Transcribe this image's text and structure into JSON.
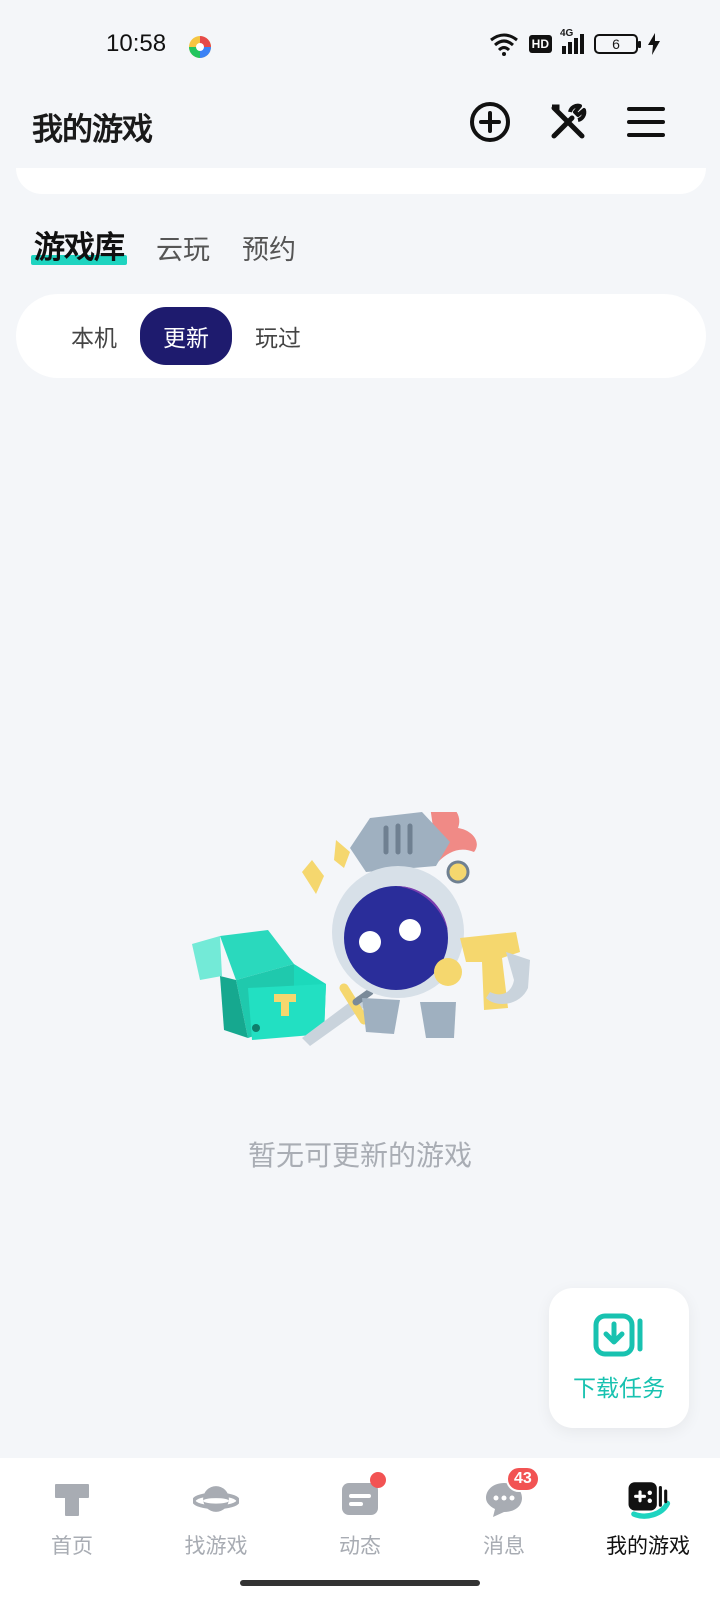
{
  "status_bar": {
    "time": "10:58",
    "network": "4G",
    "hd": "HD",
    "battery": "6"
  },
  "header": {
    "title": "我的游戏"
  },
  "main_tabs": [
    {
      "label": "游戏库",
      "active": true
    },
    {
      "label": "云玩",
      "active": false
    },
    {
      "label": "预约",
      "active": false
    }
  ],
  "sub_tabs": [
    {
      "label": "本机",
      "active": false
    },
    {
      "label": "更新",
      "active": true
    },
    {
      "label": "玩过",
      "active": false
    }
  ],
  "empty_state": {
    "message": "暂无可更新的游戏"
  },
  "download_task": {
    "label": "下载任务"
  },
  "bottom_nav": [
    {
      "label": "首页",
      "icon": "home-icon",
      "active": false
    },
    {
      "label": "找游戏",
      "icon": "planet-icon",
      "active": false
    },
    {
      "label": "动态",
      "icon": "feed-icon",
      "active": false
    },
    {
      "label": "消息",
      "icon": "message-icon",
      "active": false,
      "badge": "43"
    },
    {
      "label": "我的游戏",
      "icon": "gamepad-icon",
      "active": true
    }
  ],
  "colors": {
    "accent": "#1ed4c0",
    "segment_active": "#1e1b6e",
    "badge": "#f25353",
    "download": "#18c2b0"
  }
}
